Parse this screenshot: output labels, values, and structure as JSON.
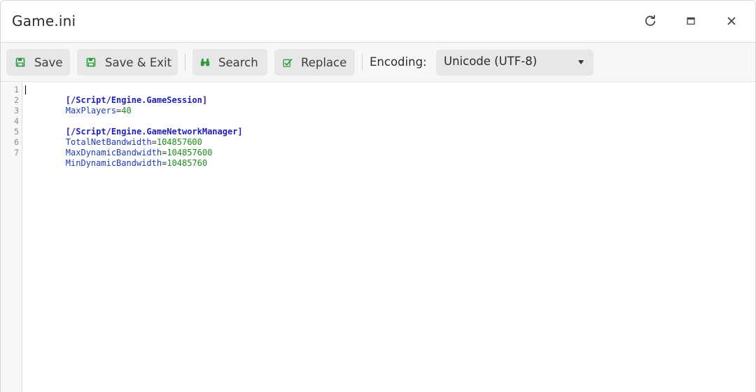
{
  "window": {
    "title": "Game.ini"
  },
  "toolbar": {
    "save_label": "Save",
    "save_exit_label": "Save & Exit",
    "search_label": "Search",
    "replace_label": "Replace",
    "encoding_label": "Encoding:",
    "encoding_value": "Unicode (UTF-8)"
  },
  "editor": {
    "line_numbers": [
      "1",
      "2",
      "3",
      "4",
      "5",
      "6",
      "7"
    ],
    "lines": [
      {
        "section": "[/Script/Engine.GameSession]"
      },
      {
        "key": "MaxPlayers",
        "eq": "=",
        "value": "40"
      },
      {},
      {
        "section": "[/Script/Engine.GameNetworkManager]"
      },
      {
        "key": "TotalNetBandwidth",
        "eq": "=",
        "value": "104857600"
      },
      {
        "key": "MaxDynamicBandwidth",
        "eq": "=",
        "value": "104857600"
      },
      {
        "key": "MinDynamicBandwidth",
        "eq": "=",
        "value": "10485760"
      }
    ]
  },
  "colors": {
    "section": "#1f1fb4",
    "key": "#1f3bb4",
    "value": "#1b8c1b",
    "button_icon": "#2e9a3a"
  },
  "icons": [
    "refresh-icon",
    "maximize-icon",
    "close-icon",
    "save-icon",
    "save-exit-icon",
    "binoculars-icon",
    "replace-icon",
    "chevron-down-icon"
  ]
}
